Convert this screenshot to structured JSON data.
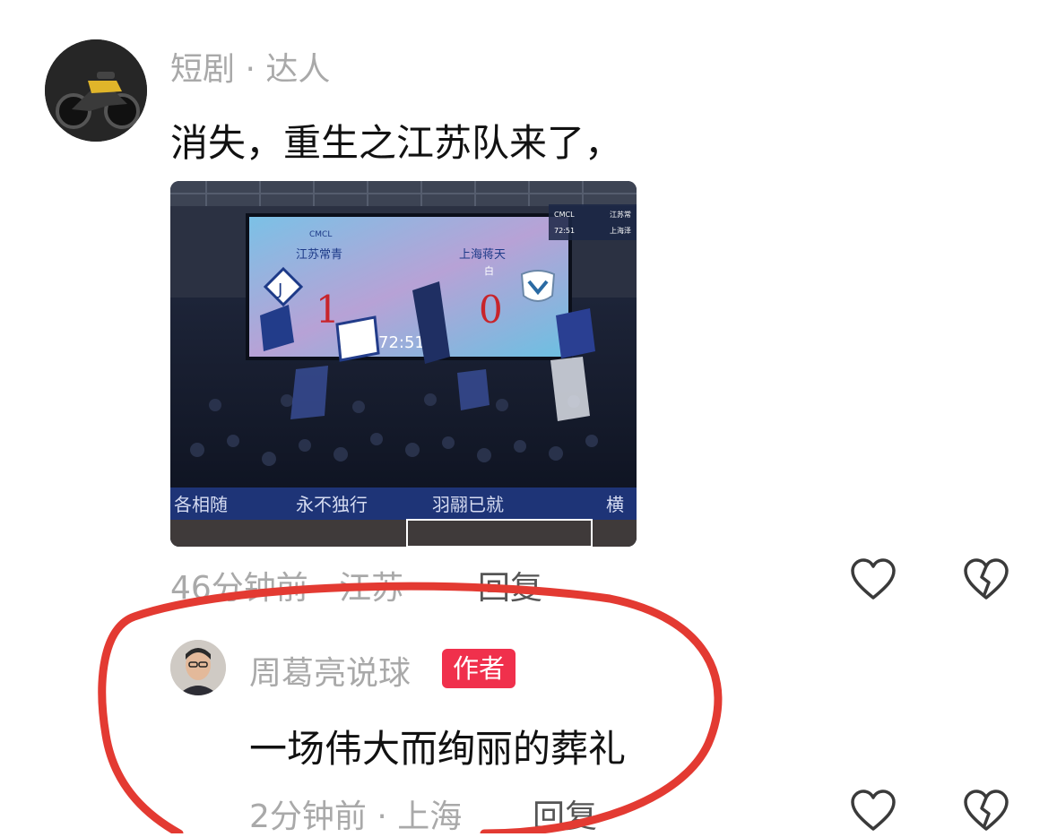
{
  "comments": [
    {
      "username": "短剧 · 达人",
      "text": "消失，重生之江苏队来了，",
      "time_location": "46分钟前 · 江苏",
      "reply_label": "回复",
      "image": {
        "scoreboard": {
          "home_team": "江苏常青",
          "away_team": "上海蒋天",
          "home_score": "1",
          "away_score": "0",
          "away_note": "白",
          "clock": "72:51",
          "league": "CMCL"
        },
        "broadcast_overlay": {
          "league": "CMCL",
          "clock": "72:51",
          "home_abbr": "江苏常",
          "away_abbr": "上海泽"
        },
        "banner_text": [
          "各相随",
          "永不独行",
          "羽翮已就",
          "横"
        ]
      }
    },
    {
      "username": "周葛亮说球",
      "badge": "作者",
      "text": "一场伟大而绚丽的葬礼",
      "time_location": "2分钟前 · 上海",
      "reply_label": "回复"
    }
  ],
  "icons": {
    "like": "heart-outline-icon",
    "dislike": "broken-heart-icon"
  },
  "colors": {
    "badge_bg": "#f0304c",
    "annotation_circle": "#e33a32",
    "meta_text": "#a9a9a9"
  }
}
